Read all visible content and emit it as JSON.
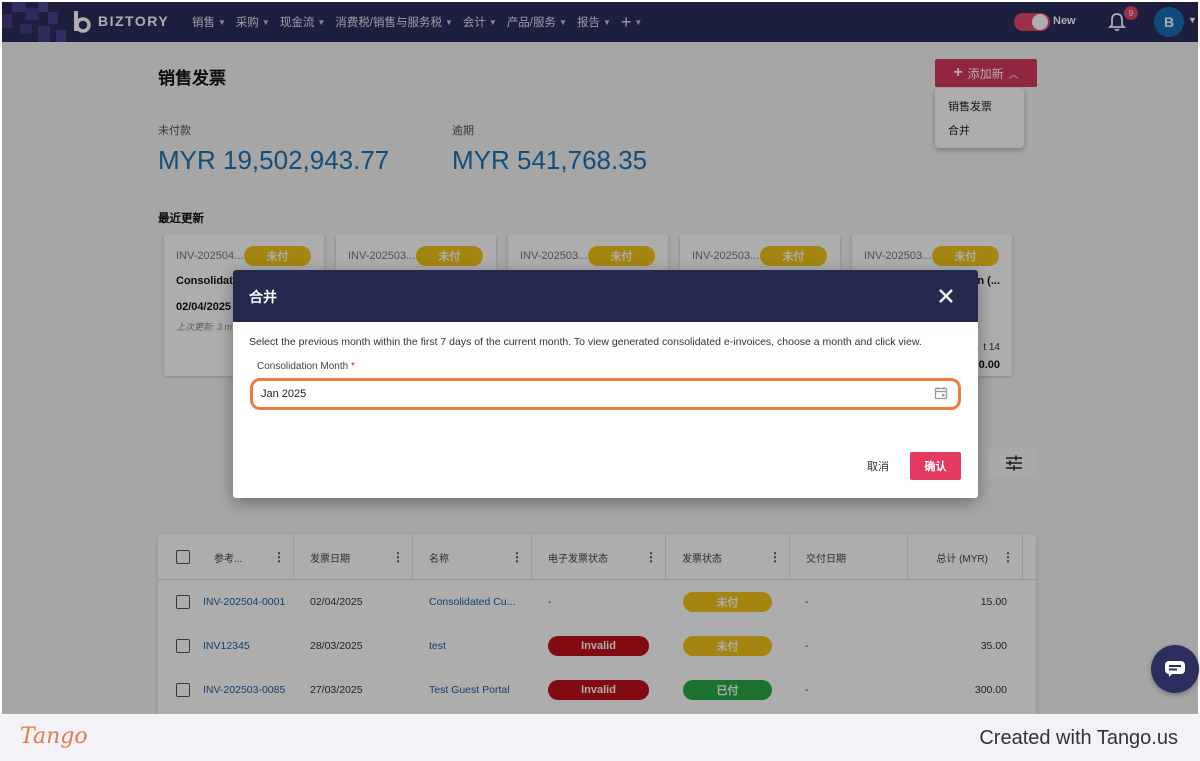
{
  "app": {
    "brand": "BIZTORY",
    "nav": [
      "销售",
      "采购",
      "现金流",
      "消费税/销售与服务税",
      "会计",
      "产品/服务",
      "报告"
    ],
    "toggle_label": "New",
    "notif_count": "9",
    "avatar_initial": "B"
  },
  "page": {
    "title": "销售发票",
    "add_button": "添加新",
    "add_menu": [
      "销售发票",
      "合并"
    ],
    "stats": [
      {
        "label": "未付款",
        "value": "MYR 19,502,943.77"
      },
      {
        "label": "逾期",
        "value": "MYR 541,768.35"
      }
    ],
    "recent_title": "最近更新",
    "cards": [
      {
        "ref": "INV-202504...",
        "badge": "未付",
        "name": "Consolidate",
        "date": "02/04/2025",
        "updated": "上次更新: 3 m",
        "due": "",
        "amount": ""
      },
      {
        "ref": "INV-202503...",
        "badge": "未付",
        "name": "",
        "date": "",
        "updated": "",
        "due": "",
        "amount": ""
      },
      {
        "ref": "INV-202503...",
        "badge": "未付",
        "name": "",
        "date": "",
        "updated": "",
        "due": "",
        "amount": ""
      },
      {
        "ref": "INV-202503...",
        "badge": "未付",
        "name": "",
        "date": "",
        "updated": "",
        "due": "",
        "amount": ""
      },
      {
        "ref": "INV-202503...",
        "badge": "未付",
        "name": "n (...",
        "date": "",
        "updated": "",
        "due": "t 14",
        "amount": "0.00"
      }
    ]
  },
  "table": {
    "columns": [
      "参考...",
      "发票日期",
      "名称",
      "电子发票状态",
      "发票状态",
      "交付日期",
      "总计 (MYR)"
    ],
    "rows": [
      {
        "ref": "INV-202504-0001",
        "date": "02/04/2025",
        "name": "Consolidated Cu...",
        "einv": "-",
        "einv_color": "",
        "status": "未付",
        "status_color": "yellow",
        "delivery": "-",
        "total": "15.00"
      },
      {
        "ref": "INV12345",
        "date": "28/03/2025",
        "name": "test",
        "einv": "Invalid",
        "einv_color": "red",
        "status": "未付",
        "status_color": "yellow",
        "delivery": "-",
        "total": "35.00"
      },
      {
        "ref": "INV-202503-0085",
        "date": "27/03/2025",
        "name": "Test Guest Portal",
        "einv": "Invalid",
        "einv_color": "red",
        "status": "已付",
        "status_color": "green",
        "delivery": "-",
        "total": "300.00"
      }
    ]
  },
  "modal": {
    "title": "合并",
    "description": "Select the previous month within the first 7 days of the current month. To view generated consolidated e-invoices, choose a month and click view.",
    "field_label": "Consolidation Month",
    "required_mark": "*",
    "field_value": "Jan 2025",
    "cancel": "取消",
    "confirm": "确认"
  },
  "footer": {
    "logo": "Tango",
    "created_with": "Created with Tango.us"
  },
  "colors": {
    "nav_bg": "#2b2e5e",
    "accent": "#d63a5c",
    "stat_blue": "#1d73b5",
    "badge_yellow": "#f0c419",
    "invalid_red": "#c0101a",
    "paid_green": "#27a844",
    "focus_orange": "#f27a3c"
  }
}
